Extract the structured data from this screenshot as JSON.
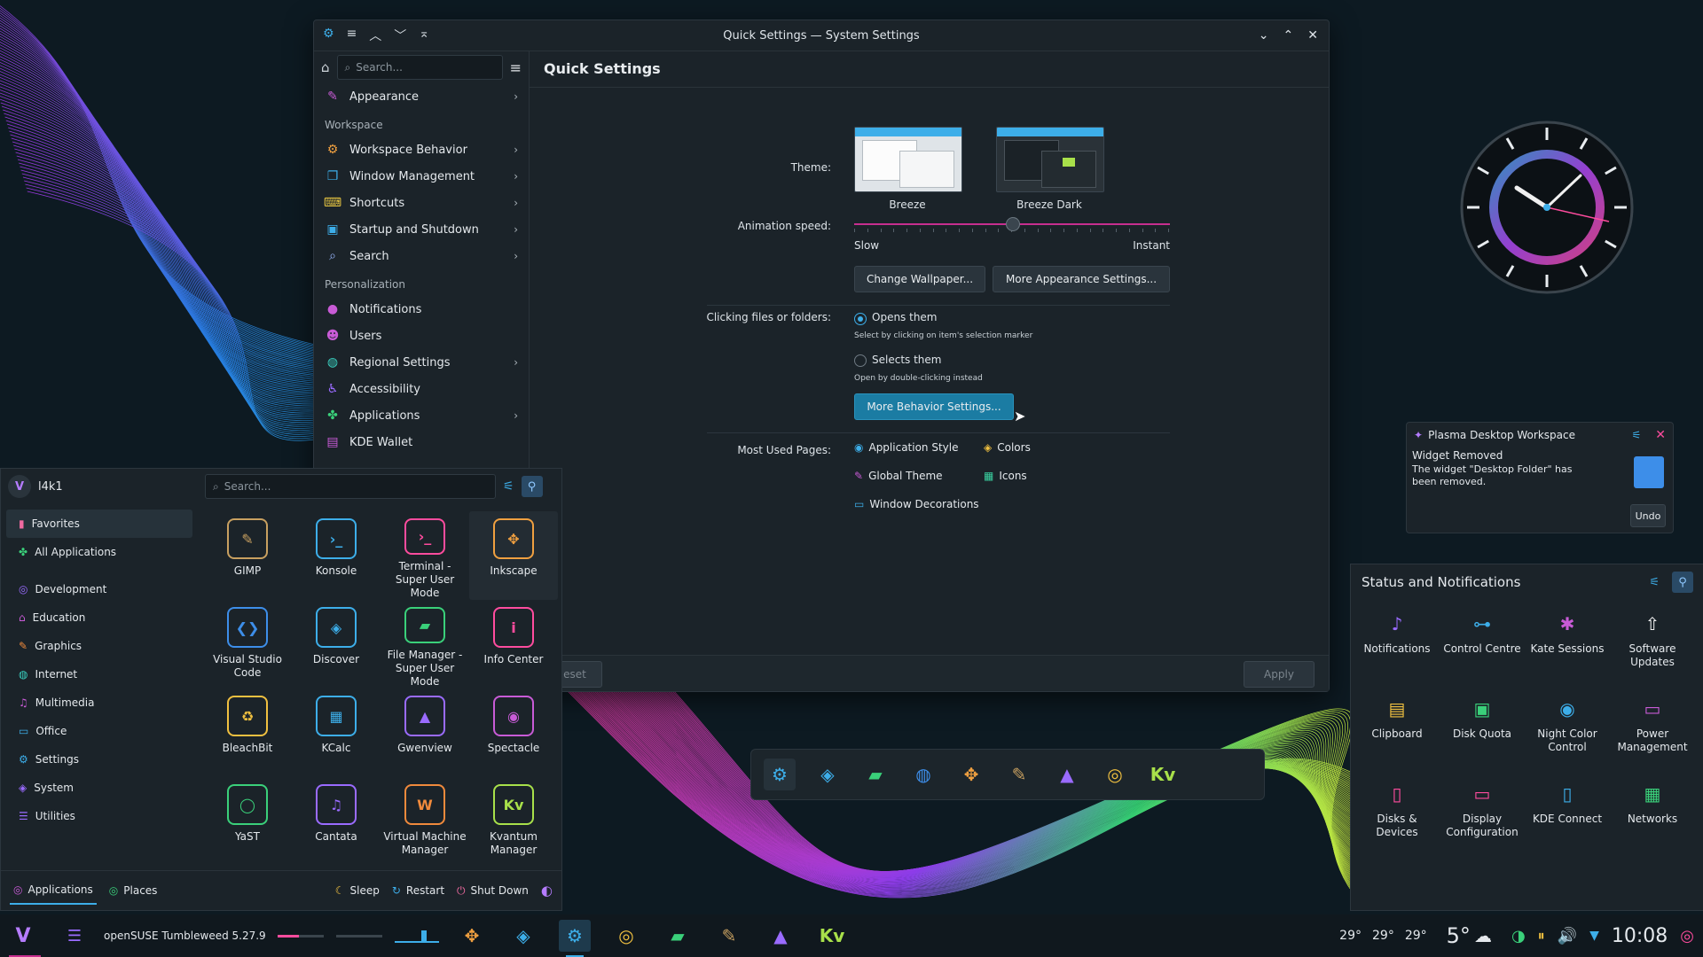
{
  "window": {
    "title": "Quick Settings — System Settings",
    "sidebar": {
      "search_placeholder": "Search...",
      "appearance": "Appearance",
      "section_workspace": "Workspace",
      "workspace_items": [
        "Workspace Behavior",
        "Window Management",
        "Shortcuts",
        "Startup and Shutdown",
        "Search"
      ],
      "section_personalization": "Personalization",
      "personalization_items": [
        "Notifications",
        "Users",
        "Regional Settings",
        "Accessibility",
        "Applications",
        "KDE Wallet"
      ]
    },
    "content": {
      "title": "Quick Settings",
      "theme_label": "Theme:",
      "theme_light": "Breeze",
      "theme_dark": "Breeze Dark",
      "animation_label": "Animation speed:",
      "animation_value": 0.5,
      "slow": "Slow",
      "instant": "Instant",
      "change_wallpaper": "Change Wallpaper...",
      "more_appearance": "More Appearance Settings...",
      "clicking_label": "Clicking files or folders:",
      "opens_them": "Opens them",
      "opens_hint": "Select by clicking on item's selection marker",
      "selects_them": "Selects them",
      "selects_hint": "Open by double-clicking instead",
      "more_behavior": "More Behavior Settings...",
      "most_used_label": "Most Used Pages:",
      "most_used": [
        "Application Style",
        "Colors",
        "Global Theme",
        "Icons",
        "Window Decorations"
      ],
      "reset": "eset",
      "apply": "Apply"
    }
  },
  "launcher": {
    "user": "l4k1",
    "search_placeholder": "Search...",
    "categories": [
      "Favorites",
      "All Applications",
      "Development",
      "Education",
      "Graphics",
      "Internet",
      "Multimedia",
      "Office",
      "Settings",
      "System",
      "Utilities"
    ],
    "apps": [
      {
        "name": "GIMP",
        "icon": "gimp-icon"
      },
      {
        "name": "Konsole",
        "icon": "konsole-icon"
      },
      {
        "name": "Terminal - Super User Mode",
        "icon": "terminal-icon"
      },
      {
        "name": "Inkscape",
        "icon": "inkscape-icon"
      },
      {
        "name": "Visual Studio Code",
        "icon": "vscode-icon"
      },
      {
        "name": "Discover",
        "icon": "discover-icon"
      },
      {
        "name": "File Manager - Super User Mode",
        "icon": "file-manager-icon"
      },
      {
        "name": "Info Center",
        "icon": "info-center-icon"
      },
      {
        "name": "BleachBit",
        "icon": "bleachbit-icon"
      },
      {
        "name": "KCalc",
        "icon": "kcalc-icon"
      },
      {
        "name": "Gwenview",
        "icon": "gwenview-icon"
      },
      {
        "name": "Spectacle",
        "icon": "spectacle-icon"
      },
      {
        "name": "YaST",
        "icon": "yast-icon"
      },
      {
        "name": "Cantata",
        "icon": "cantata-icon"
      },
      {
        "name": "Virtual Machine Manager",
        "icon": "virt-manager-icon"
      },
      {
        "name": "Kvantum Manager",
        "icon": "kvantum-icon"
      }
    ],
    "footer": {
      "applications": "Applications",
      "places": "Places",
      "sleep": "Sleep",
      "restart": "Restart",
      "shutdown": "Shut Down"
    }
  },
  "notification": {
    "app": "Plasma Desktop Workspace",
    "title": "Widget Removed",
    "body": "The widget \"Desktop Folder\" has been removed.",
    "undo": "Undo"
  },
  "status": {
    "title": "Status and Notifications",
    "items": [
      "Notifications",
      "Control Centre",
      "Kate Sessions",
      "Software Updates",
      "Clipboard",
      "Disk Quota",
      "Night Color Control",
      "Power Management",
      "Disks & Devices",
      "Display Configuration",
      "KDE Connect",
      "Networks"
    ]
  },
  "panel": {
    "distro": "openSUSE Tumbleweed 5.27.9",
    "temps": [
      "29°",
      "29°",
      "29°"
    ],
    "weather": "5°",
    "time": "10:08"
  },
  "colors": {
    "accent": "#3daee9",
    "primary_button": "#1b7ca3",
    "slider_track": "#c72e8f"
  }
}
